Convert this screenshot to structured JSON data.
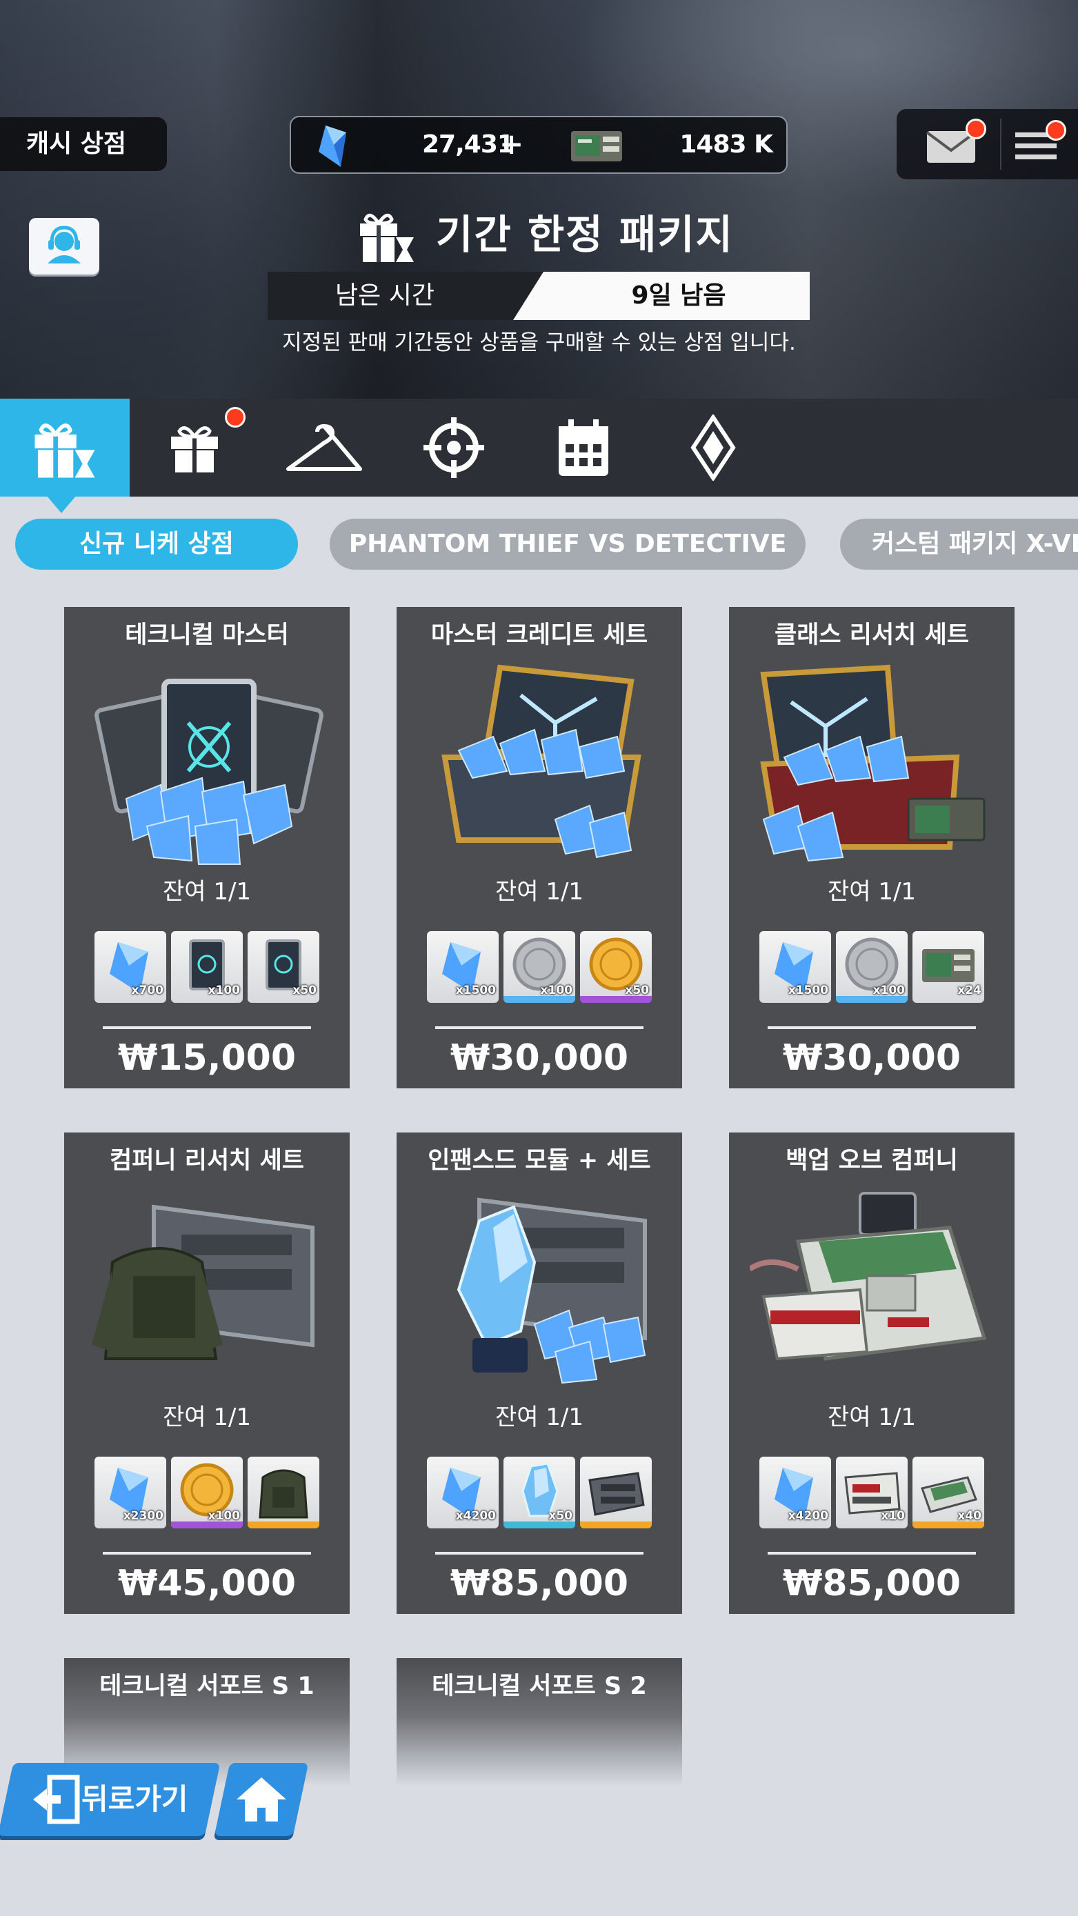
{
  "header": {
    "shop_title": "캐시 상점",
    "gem_amount": "27,431",
    "gem_plus": "+",
    "credit_amount": "1483 K",
    "package_title": "기간 한정 패키지",
    "time_label": "남은 시간",
    "time_value": "9일 남음",
    "description": "지정된 판매 기간동안 상품을 구매할 수 있는 상점 입니다.",
    "mail_icon": "mail-icon",
    "menu_icon": "menu-icon",
    "support_icon": "support-agent-icon"
  },
  "tabs": [
    {
      "icon": "limited-package-icon",
      "active": true
    },
    {
      "icon": "gift-box-icon",
      "badge": true
    },
    {
      "icon": "hanger-icon"
    },
    {
      "icon": "crosshair-icon"
    },
    {
      "icon": "calendar-icon"
    },
    {
      "icon": "gem-diamond-icon"
    }
  ],
  "subtabs": [
    {
      "label": "신규  니케 상점",
      "active": true
    },
    {
      "label": "PHANTOM THIEF VS DETECTIVE"
    },
    {
      "label": "커스텀 패키지 X-VE"
    }
  ],
  "products": [
    {
      "name": "테크니컬 마스터",
      "remain": "잔여 1/1",
      "price": "₩15,000",
      "rewards": [
        {
          "icon": "gem-icon",
          "qty": "x700",
          "band": ""
        },
        {
          "icon": "card-icon",
          "qty": "x100",
          "band": ""
        },
        {
          "icon": "card-icon",
          "qty": "x50",
          "band": ""
        }
      ]
    },
    {
      "name": "마스터 크레디트 세트",
      "remain": "잔여 1/1",
      "price": "₩30,000",
      "rewards": [
        {
          "icon": "gem-icon",
          "qty": "x1500",
          "band": ""
        },
        {
          "icon": "silver-coin-icon",
          "qty": "x100",
          "band": "#56b4f0"
        },
        {
          "icon": "gold-coin-icon",
          "qty": "x50",
          "band": "#a055d8"
        }
      ]
    },
    {
      "name": "클래스 리서치 세트",
      "remain": "잔여 1/1",
      "price": "₩30,000",
      "rewards": [
        {
          "icon": "gem-icon",
          "qty": "x1500",
          "band": ""
        },
        {
          "icon": "silver-coin-icon",
          "qty": "x100",
          "band": "#56b4f0"
        },
        {
          "icon": "credit-chip-icon",
          "qty": "x24",
          "band": ""
        }
      ]
    },
    {
      "name": "컴퍼니 리서치 세트",
      "remain": "잔여 1/1",
      "price": "₩45,000",
      "rewards": [
        {
          "icon": "gem-icon",
          "qty": "x2300",
          "band": ""
        },
        {
          "icon": "gold-coin-icon",
          "qty": "x100",
          "band": "#a055d8"
        },
        {
          "icon": "armor-vest-icon",
          "qty": "",
          "band": "#f3a623"
        }
      ]
    },
    {
      "name": "인팬스드 모듈 + 세트",
      "remain": "잔여 1/1",
      "price": "₩85,000",
      "rewards": [
        {
          "icon": "gem-icon",
          "qty": "x4200",
          "band": ""
        },
        {
          "icon": "crystal-module-icon",
          "qty": "x50",
          "band": "#3fb8d9"
        },
        {
          "icon": "equipment-crate-icon",
          "qty": "",
          "band": "#f3a623"
        }
      ]
    },
    {
      "name": "백업 오브 컴퍼니",
      "remain": "잔여 1/1",
      "price": "₩85,000",
      "rewards": [
        {
          "icon": "gem-icon",
          "qty": "x4200",
          "band": ""
        },
        {
          "icon": "data-device-icon",
          "qty": "x10",
          "band": ""
        },
        {
          "icon": "module-board-icon",
          "qty": "x40",
          "band": "#f3a623"
        }
      ]
    },
    {
      "name": "테크니컬 서포트 S 1"
    },
    {
      "name": "테크니컬 서포트 S 2"
    }
  ],
  "nav": {
    "back_label": "뒤로가기",
    "back_icon": "exit-door-icon",
    "home_icon": "home-icon"
  },
  "colors": {
    "accent": "#2fb6e9",
    "card_bg": "#4c4d51",
    "badge": "#ff3b1f",
    "page_bg": "#d9dde3",
    "nav_button": "#2f8fe0"
  }
}
